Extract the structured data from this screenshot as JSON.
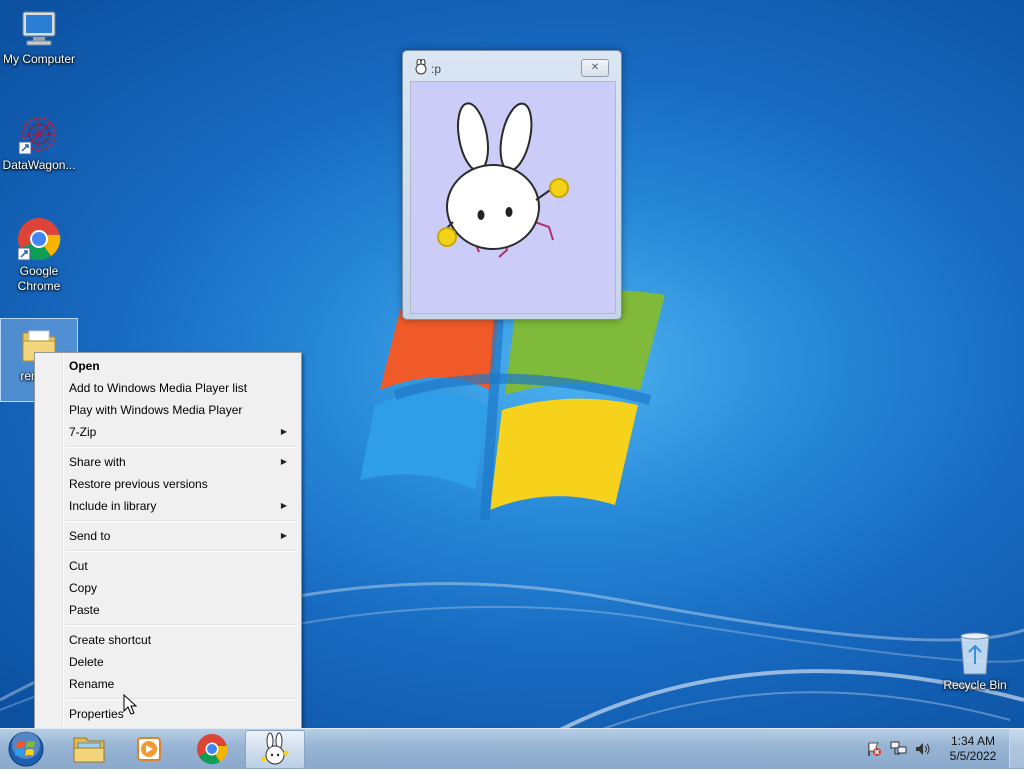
{
  "desktop_icons": [
    {
      "label": "My Computer"
    },
    {
      "label": "DataWagon..."
    },
    {
      "label": "Google Chrome"
    },
    {
      "label": "remem"
    },
    {
      "label": "Recycle Bin"
    }
  ],
  "sticker_window": {
    "title": ":p",
    "close_glyph": "✕"
  },
  "context_menu": {
    "items": [
      {
        "label": "Open",
        "bold": true
      },
      {
        "label": "Add to Windows Media Player list"
      },
      {
        "label": "Play with Windows Media Player"
      },
      {
        "label": "7-Zip",
        "submenu": true
      },
      {
        "label": "Share with",
        "submenu": true
      },
      {
        "label": "Restore previous versions"
      },
      {
        "label": "Include in library",
        "submenu": true
      },
      {
        "label": "Send to",
        "submenu": true
      },
      {
        "label": "Cut"
      },
      {
        "label": "Copy"
      },
      {
        "label": "Paste"
      },
      {
        "label": "Create shortcut"
      },
      {
        "label": "Delete"
      },
      {
        "label": "Rename"
      },
      {
        "label": "Properties"
      }
    ],
    "submenu_arrow": "▶"
  },
  "taskbar": {
    "pinned": [
      {
        "icon": "windows-explorer-icon"
      },
      {
        "icon": "media-player-icon"
      },
      {
        "icon": "chrome-icon"
      },
      {
        "icon": "bunny-app-icon",
        "active": true
      }
    ],
    "tray": [
      "action-center-flag-icon",
      "network-icon",
      "volume-icon"
    ],
    "clock": {
      "time": "1:34 AM",
      "date": "5/5/2022"
    }
  }
}
